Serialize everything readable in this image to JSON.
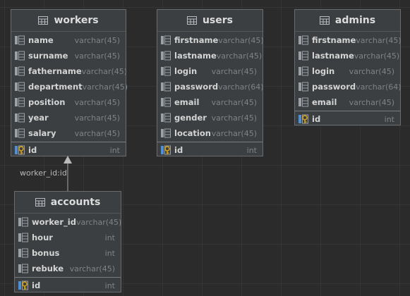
{
  "tables": {
    "workers": {
      "title": "workers",
      "columns": [
        {
          "name": "name",
          "type": "varchar(45)"
        },
        {
          "name": "surname",
          "type": "varchar(45)"
        },
        {
          "name": "fathername",
          "type": "varchar(45)"
        },
        {
          "name": "department",
          "type": "varchar(45)"
        },
        {
          "name": "position",
          "type": "varchar(45)"
        },
        {
          "name": "year",
          "type": "varchar(45)"
        },
        {
          "name": "salary",
          "type": "varchar(45)"
        }
      ],
      "pk": {
        "name": "id",
        "type": "int"
      }
    },
    "users": {
      "title": "users",
      "columns": [
        {
          "name": "firstname",
          "type": "varchar(45)"
        },
        {
          "name": "lastname",
          "type": "varchar(45)"
        },
        {
          "name": "login",
          "type": "varchar(45)"
        },
        {
          "name": "password",
          "type": "varchar(64)"
        },
        {
          "name": "email",
          "type": "varchar(45)"
        },
        {
          "name": "gender",
          "type": "varchar(45)"
        },
        {
          "name": "location",
          "type": "varchar(45)"
        }
      ],
      "pk": {
        "name": "id",
        "type": "int"
      }
    },
    "admins": {
      "title": "admins",
      "columns": [
        {
          "name": "firstname",
          "type": "varchar(45)"
        },
        {
          "name": "lastname",
          "type": "varchar(45)"
        },
        {
          "name": "login",
          "type": "varchar(45)"
        },
        {
          "name": "password",
          "type": "varchar(64)"
        },
        {
          "name": "email",
          "type": "varchar(45)"
        }
      ],
      "pk": {
        "name": "id",
        "type": "int"
      }
    },
    "accounts": {
      "title": "accounts",
      "columns": [
        {
          "name": "worker_id",
          "type": "varchar(45)"
        },
        {
          "name": "hour",
          "type": "int"
        },
        {
          "name": "bonus",
          "type": "int"
        },
        {
          "name": "rebuke",
          "type": "varchar(45)"
        }
      ],
      "pk": {
        "name": "id",
        "type": "int"
      }
    }
  },
  "relation": {
    "label": "worker_id:id",
    "from": "accounts",
    "to": "workers"
  },
  "colors": {
    "background": "#2b2b2b",
    "table_fill": "#3c3f41",
    "table_border": "#6a6d70",
    "key_icon": "#d4a017",
    "text": "#d4d4d4",
    "type_text": "#7f8385"
  }
}
